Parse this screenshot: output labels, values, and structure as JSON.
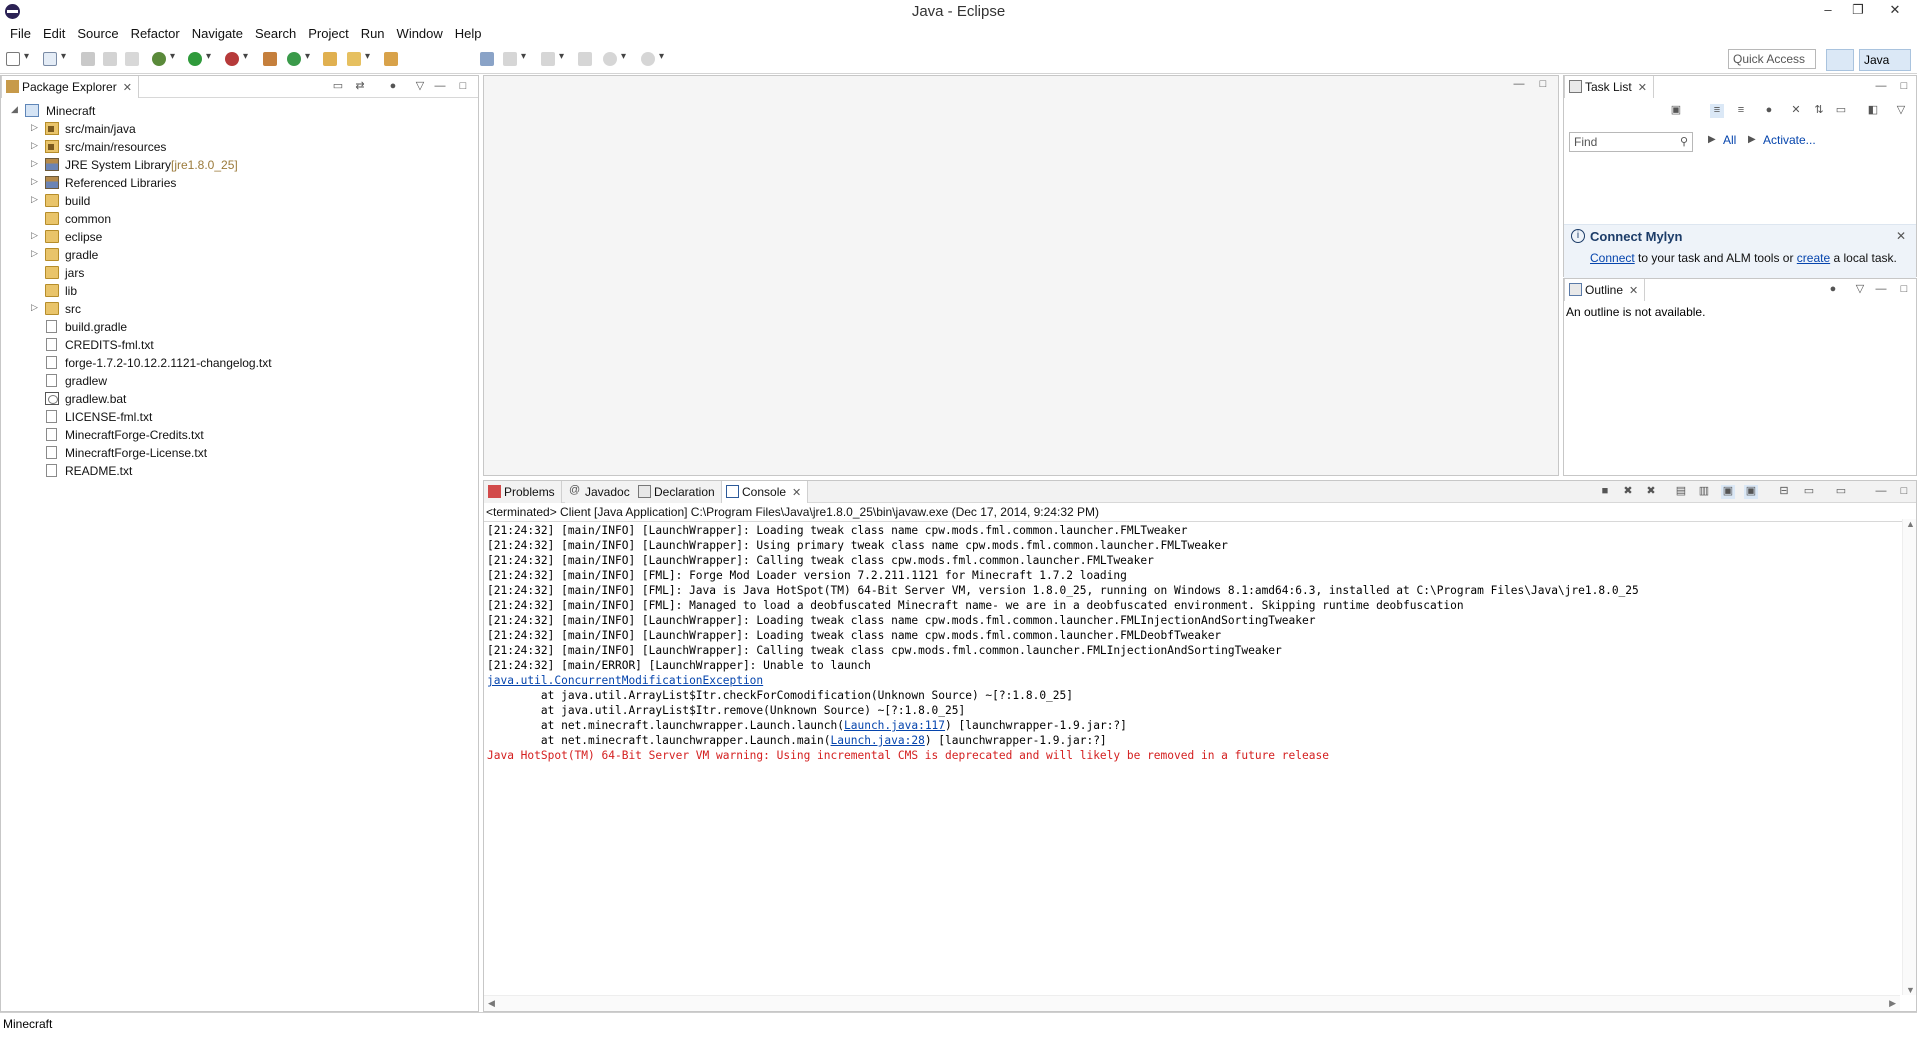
{
  "window": {
    "title": "Java - Eclipse",
    "minimize": "–",
    "restore": "❐",
    "close": "✕"
  },
  "menu": [
    "File",
    "Edit",
    "Source",
    "Refactor",
    "Navigate",
    "Search",
    "Project",
    "Run",
    "Window",
    "Help"
  ],
  "toolbar": {
    "quick_access": "Quick Access",
    "perspective": "Java"
  },
  "package_explorer": {
    "tab": "Package Explorer",
    "project": "Minecraft",
    "items": [
      {
        "label": "src/main/java",
        "icon": "source-folder-icon",
        "expandable": true,
        "deco": ""
      },
      {
        "label": "src/main/resources",
        "icon": "source-folder-icon",
        "expandable": true,
        "deco": ""
      },
      {
        "label": "JRE System Library",
        "icon": "library-icon",
        "expandable": true,
        "deco": "[jre1.8.0_25]"
      },
      {
        "label": "Referenced Libraries",
        "icon": "library-icon",
        "expandable": true,
        "deco": ""
      },
      {
        "label": "build",
        "icon": "folder-icon",
        "expandable": true,
        "deco": ""
      },
      {
        "label": "common",
        "icon": "folder-icon",
        "expandable": false,
        "deco": ""
      },
      {
        "label": "eclipse",
        "icon": "folder-icon",
        "expandable": true,
        "deco": ""
      },
      {
        "label": "gradle",
        "icon": "folder-icon",
        "expandable": true,
        "deco": ""
      },
      {
        "label": "jars",
        "icon": "folder-icon",
        "expandable": false,
        "deco": ""
      },
      {
        "label": "lib",
        "icon": "folder-icon",
        "expandable": false,
        "deco": ""
      },
      {
        "label": "src",
        "icon": "folder-icon",
        "expandable": true,
        "deco": ""
      },
      {
        "label": "build.gradle",
        "icon": "file-icon",
        "expandable": false,
        "deco": ""
      },
      {
        "label": "CREDITS-fml.txt",
        "icon": "file-icon",
        "expandable": false,
        "deco": ""
      },
      {
        "label": "forge-1.7.2-10.12.2.1121-changelog.txt",
        "icon": "file-icon",
        "expandable": false,
        "deco": ""
      },
      {
        "label": "gradlew",
        "icon": "file-icon",
        "expandable": false,
        "deco": ""
      },
      {
        "label": "gradlew.bat",
        "icon": "batch-file-icon",
        "expandable": false,
        "deco": ""
      },
      {
        "label": "LICENSE-fml.txt",
        "icon": "file-icon",
        "expandable": false,
        "deco": ""
      },
      {
        "label": "MinecraftForge-Credits.txt",
        "icon": "file-icon",
        "expandable": false,
        "deco": ""
      },
      {
        "label": "MinecraftForge-License.txt",
        "icon": "file-icon",
        "expandable": false,
        "deco": ""
      },
      {
        "label": "README.txt",
        "icon": "file-icon",
        "expandable": false,
        "deco": ""
      }
    ]
  },
  "task_list": {
    "tab": "Task List",
    "find_placeholder": "Find",
    "all": "All",
    "activate": "Activate...",
    "mylyn_title": "Connect Mylyn",
    "mylyn_connect": "Connect",
    "mylyn_mid": " to your task and ALM tools or ",
    "mylyn_create": "create",
    "mylyn_end": " a local task."
  },
  "outline": {
    "tab": "Outline",
    "message": "An outline is not available."
  },
  "bottom_tabs": [
    "Problems",
    "Javadoc",
    "Declaration",
    "Console"
  ],
  "console": {
    "status": "<terminated> Client [Java Application] C:\\Program Files\\Java\\jre1.8.0_25\\bin\\javaw.exe (Dec 17, 2014, 9:24:32 PM)",
    "lines": [
      "[21:24:32] [main/INFO] [LaunchWrapper]: Loading tweak class name cpw.mods.fml.common.launcher.FMLTweaker",
      "[21:24:32] [main/INFO] [LaunchWrapper]: Using primary tweak class name cpw.mods.fml.common.launcher.FMLTweaker",
      "[21:24:32] [main/INFO] [LaunchWrapper]: Calling tweak class cpw.mods.fml.common.launcher.FMLTweaker",
      "[21:24:32] [main/INFO] [FML]: Forge Mod Loader version 7.2.211.1121 for Minecraft 1.7.2 loading",
      "[21:24:32] [main/INFO] [FML]: Java is Java HotSpot(TM) 64-Bit Server VM, version 1.8.0_25, running on Windows 8.1:amd64:6.3, installed at C:\\Program Files\\Java\\jre1.8.0_25",
      "[21:24:32] [main/INFO] [FML]: Managed to load a deobfuscated Minecraft name- we are in a deobfuscated environment. Skipping runtime deobfuscation",
      "[21:24:32] [main/INFO] [LaunchWrapper]: Loading tweak class name cpw.mods.fml.common.launcher.FMLInjectionAndSortingTweaker",
      "[21:24:32] [main/INFO] [LaunchWrapper]: Loading tweak class name cpw.mods.fml.common.launcher.FMLDeobfTweaker",
      "[21:24:32] [main/INFO] [LaunchWrapper]: Calling tweak class cpw.mods.fml.common.launcher.FMLInjectionAndSortingTweaker",
      "[21:24:32] [main/ERROR] [LaunchWrapper]: Unable to launch"
    ],
    "exception": "java.util.ConcurrentModificationException",
    "trace1": "\tat java.util.ArrayList$Itr.checkForComodification(Unknown Source) ~[?:1.8.0_25]",
    "trace2": "\tat java.util.ArrayList$Itr.remove(Unknown Source) ~[?:1.8.0_25]",
    "trace3_pre": "\tat net.minecraft.launchwrapper.Launch.launch(",
    "trace3_link": "Launch.java:117",
    "trace3_post": ") [launchwrapper-1.9.jar:?]",
    "trace4_pre": "\tat net.minecraft.launchwrapper.Launch.main(",
    "trace4_link": "Launch.java:28",
    "trace4_post": ") [launchwrapper-1.9.jar:?]",
    "warning": "Java HotSpot(TM) 64-Bit Server VM warning: Using incremental CMS is deprecated and will likely be removed in a future release"
  },
  "status_bar": {
    "text": "Minecraft"
  }
}
